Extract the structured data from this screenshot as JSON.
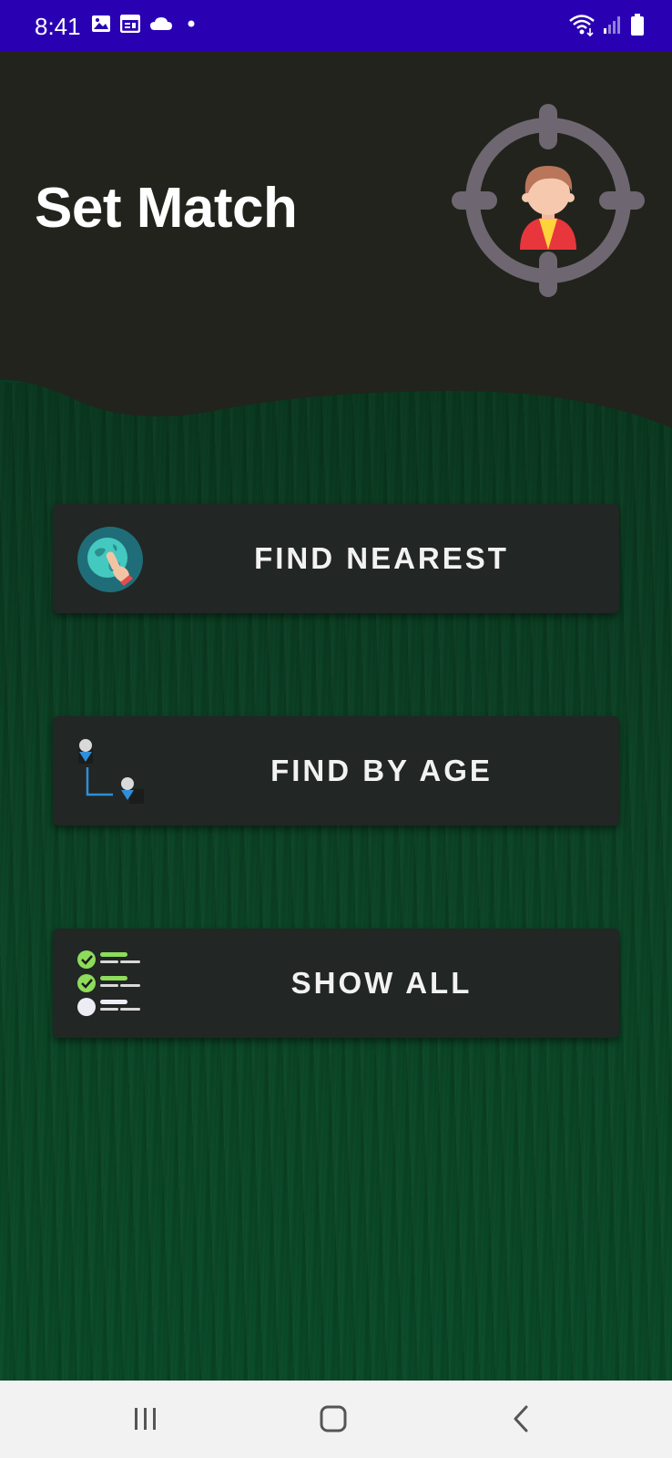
{
  "status_bar": {
    "time": "8:41",
    "left_icons": [
      "image-icon",
      "calendar-icon",
      "cloud-icon",
      "dot-icon"
    ],
    "right_icons": [
      "wifi-icon",
      "signal-icon",
      "battery-icon"
    ],
    "background": "#2a00b3"
  },
  "header": {
    "title": "Set Match",
    "logo": "crosshair-person-icon",
    "background": "#22231c"
  },
  "menu": {
    "buttons": [
      {
        "label": "FIND NEAREST",
        "icon": "globe-touch-icon"
      },
      {
        "label": "FIND BY AGE",
        "icon": "people-connection-icon"
      },
      {
        "label": "SHOW ALL",
        "icon": "checklist-icon"
      }
    ]
  },
  "nav_bar": {
    "items": [
      "recent-apps-icon",
      "home-icon",
      "back-icon"
    ]
  },
  "colors": {
    "background_green": "#0b4a28",
    "button_bg": "#222624",
    "accent_green": "#8ddc5a",
    "accent_blue": "#2f8fd8"
  }
}
